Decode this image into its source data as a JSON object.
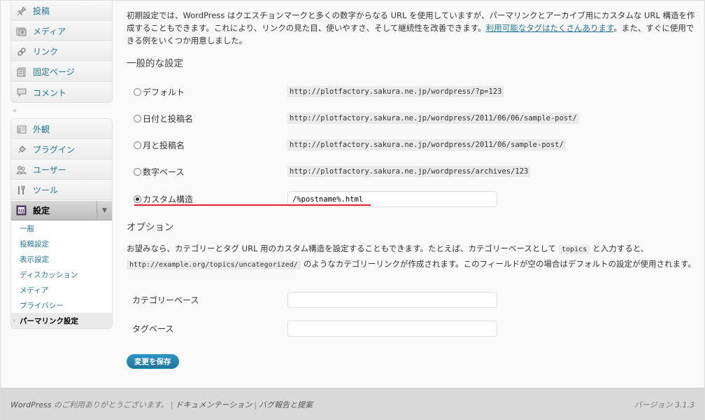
{
  "sidebar": {
    "group1": [
      {
        "icon": "pin-icon",
        "label": "投稿"
      },
      {
        "icon": "media-icon",
        "label": "メディア"
      },
      {
        "icon": "link-icon",
        "label": "リンク"
      },
      {
        "icon": "page-icon",
        "label": "固定ページ"
      },
      {
        "icon": "comment-icon",
        "label": "コメント"
      }
    ],
    "group2": [
      {
        "icon": "appearance-icon",
        "label": "外観"
      },
      {
        "icon": "plugin-icon",
        "label": "プラグイン"
      },
      {
        "icon": "users-icon",
        "label": "ユーザー"
      },
      {
        "icon": "tools-icon",
        "label": "ツール"
      }
    ],
    "settings": {
      "icon": "settings-icon",
      "label": "設定",
      "submenu": [
        "一般",
        "投稿設定",
        "表示設定",
        "ディスカッション",
        "メディア",
        "プライバシー",
        "パーマリンク設定"
      ]
    }
  },
  "main": {
    "intro_part1": "初期設定では、WordPress はクエスチョンマークと多くの数字からなる URL を使用していますが、パーマリンクとアーカイブ用にカスタムな URL 構造を作成することもできます。これにより、リンクの見た目、使いやすさ、そして継続性を改善できます。",
    "intro_link": "利用可能なタグはたくさんあります",
    "intro_part2": "。また、すぐに使用できる例をいくつか用意しました。",
    "general_heading": "一般的な設定",
    "options": [
      {
        "label": "デフォルト",
        "url": "http://plotfactory.sakura.ne.jp/wordpress/?p=123",
        "checked": false
      },
      {
        "label": "日付と投稿名",
        "url": "http://plotfactory.sakura.ne.jp/wordpress/2011/06/06/sample-post/",
        "checked": false
      },
      {
        "label": "月と投稿名",
        "url": "http://plotfactory.sakura.ne.jp/wordpress/2011/06/sample-post/",
        "checked": false
      },
      {
        "label": "数字ベース",
        "url": "http://plotfactory.sakura.ne.jp/wordpress/archives/123",
        "checked": false
      },
      {
        "label": "カスタム構造",
        "value": "/%postname%.html",
        "checked": true
      }
    ],
    "options_heading": "オプション",
    "options_desc1": "お望みなら、カテゴリーとタグ URL 用のカスタム構造を設定することもできます。たとえば、カテゴリーベースとして",
    "options_code1": "topics",
    "options_desc2": "と入力すると、",
    "options_code2": "http://example.org/topics/uncategorized/",
    "options_desc3": "のようなカテゴリーリンクが作成されます。このフィールドが空の場合はデフォルトの設定が使用されます。",
    "category_base_label": "カテゴリーベース",
    "category_base_value": "",
    "tag_base_label": "タグベース",
    "tag_base_value": "",
    "save_label": "変更を保存"
  },
  "footer": {
    "wordpress": "WordPress",
    "thanks": " のご利用ありがとうございます。",
    "docs": "ドキュメンテーション",
    "feedback": "バグ報告と提案",
    "version": "バージョン 3.1.3"
  },
  "colors": {
    "link": "#21759b",
    "highlight_underline": "#e0212b",
    "button": "#21759b"
  }
}
